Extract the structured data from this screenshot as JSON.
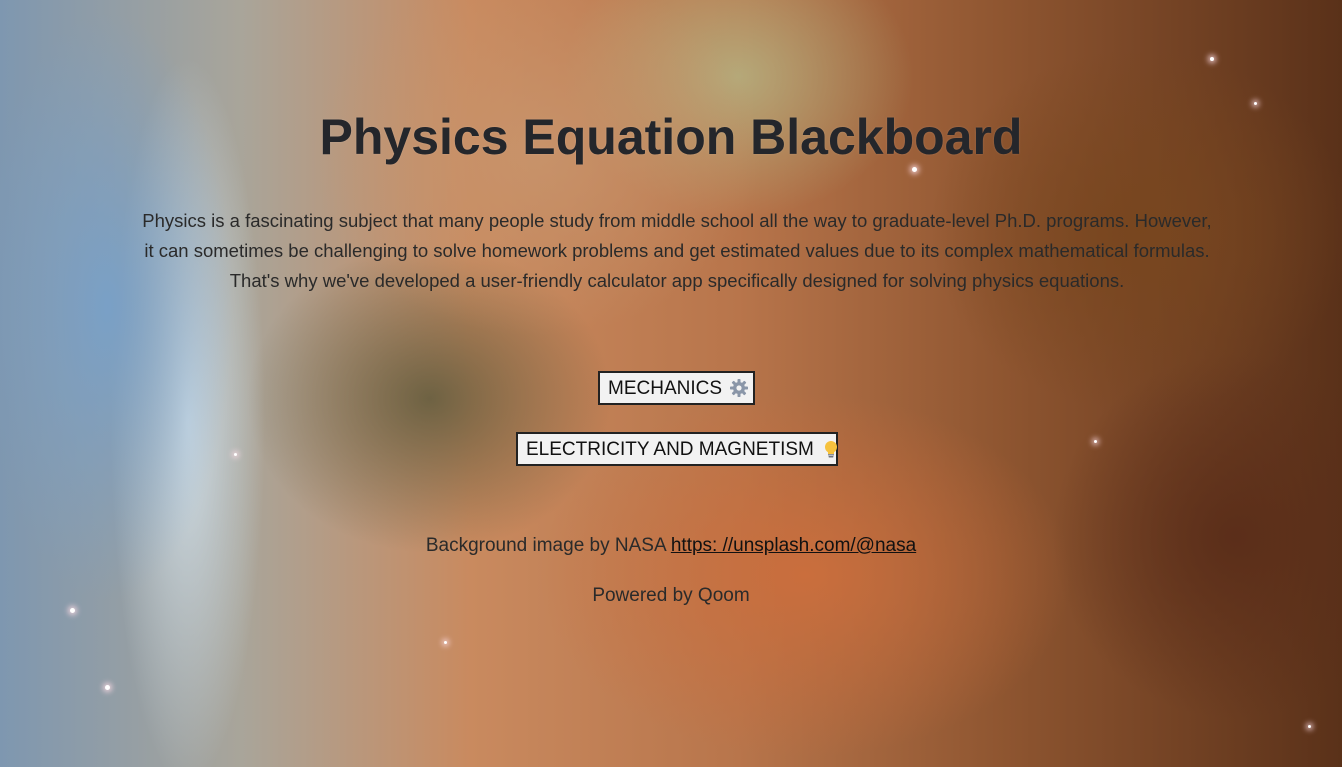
{
  "header": {
    "title": "Physics Equation Blackboard"
  },
  "intro": {
    "text": "Physics is a fascinating subject that many people study from middle school all the way to graduate-level Ph.D. programs. However, it can sometimes be challenging to solve homework problems and get estimated values due to its complex mathematical formulas. That's why we've developed a user-friendly calculator app specifically designed for solving physics equations."
  },
  "topics": [
    {
      "label": "MECHANICS",
      "icon": "gear-icon"
    },
    {
      "label": "ELECTRICITY AND MAGNETISM",
      "icon": "lightbulb-icon"
    }
  ],
  "footer": {
    "credit_prefix": "Background image by NASA ",
    "credit_link": "https: //unsplash.com/@nasa",
    "powered": "Powered by Qoom"
  },
  "colors": {
    "title": "#24262b",
    "button_bg": "#f2f2f2",
    "button_border": "#222222"
  }
}
